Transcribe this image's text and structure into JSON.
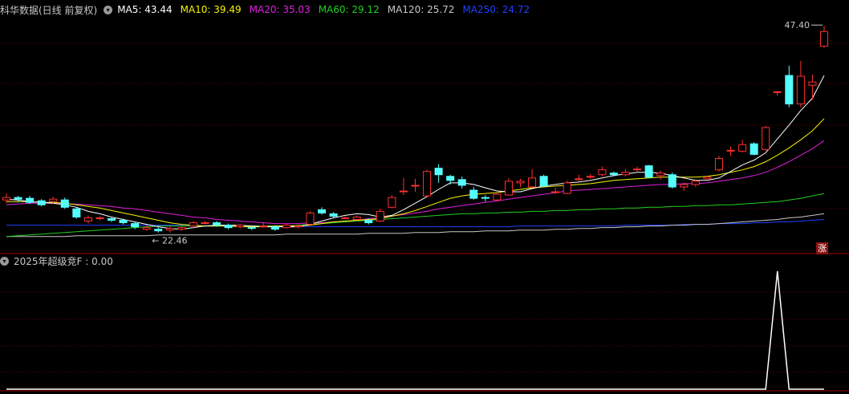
{
  "header": {
    "stock": "科华数据(日线 前复权)",
    "ma": [
      {
        "label": "MA5: 43.44",
        "color": "#ffffff"
      },
      {
        "label": "MA10: 39.49",
        "color": "#f5f500"
      },
      {
        "label": "MA20: 35.03",
        "color": "#e020e0"
      },
      {
        "label": "MA60: 29.12",
        "color": "#20d020"
      },
      {
        "label": "MA120: 25.72",
        "color": "#c8c8c8"
      },
      {
        "label": "MA250: 24.72",
        "color": "#2040ff"
      }
    ]
  },
  "price": {
    "high_label": "47.40",
    "low_label": "22.46",
    "badge": "涨"
  },
  "indicator": {
    "title": "2025年超级竞F : 0.00"
  },
  "colors": {
    "up": "#ff3030",
    "down": "#54ffff",
    "grid": "#7a0000",
    "signal": "#ffffff"
  },
  "chart_data": {
    "type": "candlestick",
    "y_range": [
      20.5,
      49.5
    ],
    "candles": [
      [
        26.5,
        26.8,
        26.1,
        27.3
      ],
      [
        26.8,
        26.6,
        26.2,
        27.0
      ],
      [
        26.7,
        26.2,
        26.0,
        27.0
      ],
      [
        26.4,
        25.9,
        25.7,
        26.6
      ],
      [
        26.3,
        26.6,
        26.0,
        26.9
      ],
      [
        26.5,
        25.6,
        25.4,
        26.8
      ],
      [
        25.4,
        24.4,
        24.2,
        25.6
      ],
      [
        23.9,
        24.3,
        23.6,
        24.6
      ],
      [
        24.2,
        24.3,
        24.0,
        24.5
      ],
      [
        24.2,
        24.0,
        23.8,
        24.4
      ],
      [
        24.0,
        23.7,
        23.5,
        24.2
      ],
      [
        23.6,
        23.2,
        22.9,
        23.8
      ],
      [
        22.9,
        23.1,
        22.7,
        23.3
      ],
      [
        22.9,
        22.7,
        22.5,
        23.1
      ],
      [
        22.8,
        23.0,
        22.5,
        23.3
      ],
      [
        22.9,
        23.1,
        22.7,
        23.4
      ],
      [
        23.3,
        23.7,
        23.0,
        23.9
      ],
      [
        23.6,
        23.7,
        23.5,
        23.9
      ],
      [
        23.7,
        23.4,
        23.2,
        23.9
      ],
      [
        23.4,
        23.1,
        22.9,
        23.6
      ],
      [
        23.2,
        23.4,
        23.0,
        23.6
      ],
      [
        23.1,
        23.0,
        22.8,
        23.3
      ],
      [
        23.3,
        23.3,
        23.1,
        23.7
      ],
      [
        23.2,
        22.9,
        22.7,
        23.4
      ],
      [
        23.1,
        23.4,
        23.0,
        23.6
      ],
      [
        23.2,
        23.3,
        23.0,
        23.5
      ],
      [
        23.5,
        24.9,
        23.4,
        25.1
      ],
      [
        25.3,
        24.9,
        24.7,
        25.6
      ],
      [
        24.8,
        24.5,
        24.3,
        25.0
      ],
      [
        24.3,
        24.3,
        24.1,
        24.5
      ],
      [
        24.1,
        24.4,
        23.9,
        24.6
      ],
      [
        24.0,
        23.7,
        23.5,
        24.2
      ],
      [
        23.9,
        25.1,
        23.8,
        25.4
      ],
      [
        25.6,
        26.8,
        25.5,
        27.1
      ],
      [
        27.6,
        27.6,
        27.1,
        29.2
      ],
      [
        28.2,
        28.3,
        27.5,
        29.1
      ],
      [
        27.0,
        30.0,
        26.8,
        30.2
      ],
      [
        30.4,
        29.6,
        28.6,
        30.9
      ],
      [
        29.4,
        28.9,
        28.4,
        29.6
      ],
      [
        29.0,
        28.3,
        27.9,
        29.4
      ],
      [
        27.7,
        26.7,
        26.5,
        28.1
      ],
      [
        26.8,
        26.7,
        26.3,
        27.1
      ],
      [
        26.5,
        27.2,
        26.3,
        27.4
      ],
      [
        27.1,
        28.8,
        27.0,
        29.2
      ],
      [
        28.6,
        28.8,
        28.1,
        29.1
      ],
      [
        28.1,
        29.2,
        28.0,
        30.3
      ],
      [
        29.4,
        28.2,
        28.1,
        29.6
      ],
      [
        27.5,
        27.5,
        27.2,
        28.0
      ],
      [
        27.3,
        28.6,
        27.2,
        28.9
      ],
      [
        29.1,
        29.1,
        28.8,
        29.6
      ],
      [
        29.4,
        29.4,
        29.1,
        29.7
      ],
      [
        29.6,
        30.2,
        29.4,
        30.6
      ],
      [
        29.8,
        29.6,
        29.4,
        30.0
      ],
      [
        29.6,
        29.9,
        29.4,
        30.3
      ],
      [
        30.3,
        30.3,
        30.0,
        30.6
      ],
      [
        30.7,
        29.3,
        29.2,
        30.8
      ],
      [
        29.5,
        29.8,
        29.0,
        30.1
      ],
      [
        29.6,
        28.1,
        27.9,
        29.9
      ],
      [
        28.1,
        28.4,
        27.6,
        28.6
      ],
      [
        28.4,
        28.8,
        28.1,
        29.0
      ],
      [
        29.1,
        29.3,
        28.8,
        29.5
      ],
      [
        30.2,
        31.6,
        30.0,
        31.9
      ],
      [
        32.6,
        32.6,
        31.9,
        33.1
      ],
      [
        32.5,
        33.3,
        32.3,
        33.9
      ],
      [
        33.4,
        32.1,
        32.0,
        33.6
      ],
      [
        32.7,
        35.4,
        32.5,
        35.6
      ],
      [
        39.8,
        39.8,
        39.3,
        39.9
      ],
      [
        41.8,
        38.3,
        37.9,
        43.0
      ],
      [
        38.3,
        41.7,
        37.9,
        43.6
      ],
      [
        40.6,
        41.0,
        38.8,
        41.9
      ],
      [
        45.4,
        47.2,
        45.2,
        47.9
      ]
    ],
    "ma5": [
      26.6,
      26.5,
      26.3,
      26.2,
      26.1,
      25.9,
      25.6,
      25.1,
      24.8,
      24.4,
      24.1,
      23.8,
      23.5,
      23.2,
      23.0,
      22.9,
      23.1,
      23.3,
      23.4,
      23.4,
      23.4,
      23.3,
      23.2,
      23.2,
      23.2,
      23.2,
      23.5,
      23.9,
      24.3,
      24.6,
      24.8,
      24.7,
      24.4,
      24.6,
      25.3,
      26.1,
      26.9,
      27.8,
      28.6,
      28.6,
      28.4,
      28.0,
      27.6,
      27.5,
      27.5,
      27.9,
      28.2,
      28.4,
      28.6,
      28.7,
      28.9,
      29.2,
      29.5,
      29.7,
      29.9,
      29.9,
      29.8,
      29.5,
      29.2,
      28.9,
      28.9,
      29.2,
      30.0,
      30.8,
      31.4,
      32.3,
      34.0,
      35.7,
      37.5,
      39.0,
      41.8
    ],
    "ma10": [
      26.3,
      26.3,
      26.3,
      26.2,
      26.2,
      26.1,
      25.9,
      25.7,
      25.5,
      25.2,
      24.9,
      24.6,
      24.3,
      24.0,
      23.7,
      23.5,
      23.4,
      23.3,
      23.3,
      23.3,
      23.2,
      23.2,
      23.2,
      23.3,
      23.3,
      23.3,
      23.4,
      23.6,
      23.8,
      23.9,
      24.0,
      24.1,
      24.2,
      24.5,
      24.8,
      25.2,
      25.7,
      26.2,
      26.7,
      27.0,
      27.2,
      27.3,
      27.4,
      27.6,
      27.8,
      28.0,
      28.1,
      28.2,
      28.3,
      28.4,
      28.5,
      28.7,
      28.9,
      29.0,
      29.1,
      29.2,
      29.3,
      29.3,
      29.3,
      29.3,
      29.4,
      29.6,
      29.9,
      30.2,
      30.6,
      31.2,
      32.0,
      32.9,
      33.9,
      35.0,
      36.5
    ],
    "ma20": [
      25.9,
      26.0,
      26.1,
      26.1,
      26.1,
      26.0,
      26.0,
      25.9,
      25.8,
      25.7,
      25.5,
      25.4,
      25.2,
      25.0,
      24.8,
      24.6,
      24.4,
      24.3,
      24.1,
      24.0,
      23.9,
      23.8,
      23.7,
      23.6,
      23.6,
      23.6,
      23.7,
      23.7,
      23.8,
      23.9,
      24.0,
      24.2,
      24.3,
      24.5,
      24.7,
      24.9,
      25.1,
      25.4,
      25.6,
      25.8,
      26.0,
      26.2,
      26.4,
      26.6,
      26.8,
      27.0,
      27.2,
      27.4,
      27.6,
      27.7,
      27.8,
      27.9,
      28.0,
      28.1,
      28.2,
      28.3,
      28.4,
      28.4,
      28.5,
      28.5,
      28.6,
      28.8,
      29.0,
      29.2,
      29.5,
      29.9,
      30.5,
      31.2,
      32.0,
      32.8,
      33.8
    ],
    "ma60": [
      22.0,
      22.1,
      22.2,
      22.3,
      22.4,
      22.5,
      22.6,
      22.7,
      22.8,
      22.9,
      23.0,
      23.1,
      23.2,
      23.3,
      23.3,
      23.3,
      23.3,
      23.3,
      23.3,
      23.3,
      23.3,
      23.3,
      23.3,
      23.3,
      23.3,
      23.4,
      23.5,
      23.6,
      23.7,
      23.8,
      23.9,
      24.0,
      24.1,
      24.2,
      24.3,
      24.4,
      24.5,
      24.6,
      24.7,
      24.8,
      24.8,
      24.9,
      24.9,
      25.0,
      25.0,
      25.1,
      25.1,
      25.2,
      25.2,
      25.3,
      25.3,
      25.4,
      25.4,
      25.5,
      25.5,
      25.6,
      25.6,
      25.7,
      25.7,
      25.8,
      25.8,
      25.9,
      25.9,
      26.0,
      26.1,
      26.2,
      26.3,
      26.5,
      26.7,
      27.0,
      27.3
    ],
    "ma120": [
      22.0,
      22.0,
      22.0,
      22.0,
      22.0,
      22.0,
      22.1,
      22.1,
      22.1,
      22.1,
      22.1,
      22.1,
      22.1,
      22.2,
      22.2,
      22.2,
      22.2,
      22.2,
      22.2,
      22.2,
      22.2,
      22.2,
      22.2,
      22.2,
      22.3,
      22.3,
      22.3,
      22.3,
      22.3,
      22.3,
      22.3,
      22.4,
      22.4,
      22.4,
      22.4,
      22.5,
      22.5,
      22.5,
      22.6,
      22.6,
      22.6,
      22.7,
      22.7,
      22.7,
      22.8,
      22.8,
      22.8,
      22.9,
      22.9,
      23.0,
      23.0,
      23.1,
      23.1,
      23.2,
      23.2,
      23.3,
      23.3,
      23.4,
      23.4,
      23.5,
      23.5,
      23.6,
      23.7,
      23.8,
      23.9,
      24.0,
      24.1,
      24.3,
      24.4,
      24.6,
      24.8
    ],
    "ma250": [
      23.4,
      23.4,
      23.4,
      23.4,
      23.4,
      23.4,
      23.4,
      23.4,
      23.4,
      23.4,
      23.4,
      23.4,
      23.4,
      23.4,
      23.4,
      23.4,
      23.3,
      23.3,
      23.3,
      23.3,
      23.3,
      23.3,
      23.3,
      23.3,
      23.2,
      23.2,
      23.2,
      23.2,
      23.2,
      23.2,
      23.2,
      23.2,
      23.2,
      23.2,
      23.2,
      23.2,
      23.2,
      23.2,
      23.2,
      23.2,
      23.2,
      23.2,
      23.2,
      23.2,
      23.3,
      23.3,
      23.3,
      23.3,
      23.3,
      23.3,
      23.3,
      23.3,
      23.3,
      23.4,
      23.4,
      23.4,
      23.4,
      23.4,
      23.5,
      23.5,
      23.5,
      23.6,
      23.6,
      23.6,
      23.7,
      23.7,
      23.8,
      23.8,
      23.9,
      24.0,
      24.1
    ],
    "indicator": {
      "y_range": [
        0,
        1
      ],
      "values": [
        0,
        0,
        0,
        0,
        0,
        0,
        0,
        0,
        0,
        0,
        0,
        0,
        0,
        0,
        0,
        0,
        0,
        0,
        0,
        0,
        0,
        0,
        0,
        0,
        0,
        0,
        0,
        0,
        0,
        0,
        0,
        0,
        0,
        0,
        0,
        0,
        0,
        0,
        0,
        0,
        0,
        0,
        0,
        0,
        0,
        0,
        0,
        0,
        0,
        0,
        0,
        0,
        0,
        0,
        0,
        0,
        0,
        0,
        0,
        0,
        0,
        0,
        0,
        0,
        0,
        0,
        1,
        0,
        0,
        0,
        0
      ]
    }
  }
}
